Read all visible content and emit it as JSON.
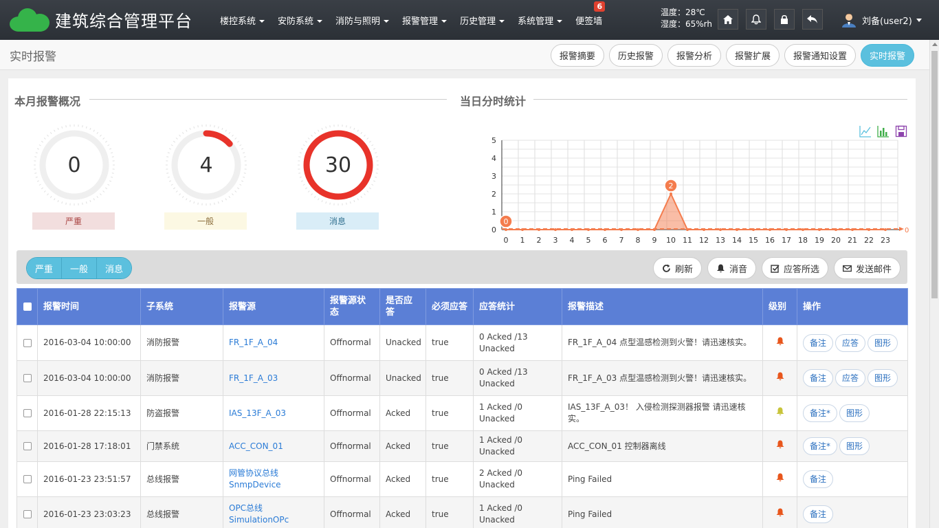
{
  "app": {
    "title": "建筑综合管理平台"
  },
  "menu": [
    {
      "label": "楼控系统",
      "caret": true
    },
    {
      "label": "安防系统",
      "caret": true
    },
    {
      "label": "消防与照明",
      "caret": true
    },
    {
      "label": "报警管理",
      "caret": true
    },
    {
      "label": "历史管理",
      "caret": true
    },
    {
      "label": "系统管理",
      "caret": true
    },
    {
      "label": "便签墙",
      "caret": false,
      "badge": "6"
    }
  ],
  "env": {
    "temperature": "温度：28℃",
    "humidity": "湿度：65%rh"
  },
  "nav_icons": [
    "home-icon",
    "bell-icon",
    "lock-icon",
    "back-icon"
  ],
  "user": {
    "name": "刘备(user2)"
  },
  "page": {
    "title": "实时报警"
  },
  "sub_tabs": [
    {
      "label": "报警摘要",
      "active": false
    },
    {
      "label": "历史报警",
      "active": false
    },
    {
      "label": "报警分析",
      "active": false
    },
    {
      "label": "报警扩展",
      "active": false
    },
    {
      "label": "报警通知设置",
      "active": false
    },
    {
      "label": "实时报警",
      "active": true
    }
  ],
  "summary": {
    "title": "本月报警概况",
    "gauges": [
      {
        "value": "0",
        "label": "严重",
        "color": "#e8332a",
        "fraction": 0.0,
        "label_bg": "#f2dede",
        "label_color": "#a94442"
      },
      {
        "value": "4",
        "label": "一般",
        "color": "#e8332a",
        "fraction": 0.133,
        "label_bg": "#fcf8e3",
        "label_color": "#8a6d3b"
      },
      {
        "value": "30",
        "label": "消息",
        "color": "#e8332a",
        "fraction": 1.0,
        "label_bg": "#d9edf7",
        "label_color": "#31708f"
      }
    ]
  },
  "hourly": {
    "title": "当日分时统计",
    "tools": [
      "line-chart-icon",
      "bar-chart-icon",
      "save-icon"
    ]
  },
  "chart_data": {
    "type": "area",
    "x": [
      "0",
      "1",
      "2",
      "3",
      "4",
      "5",
      "6",
      "7",
      "8",
      "9",
      "10",
      "11",
      "12",
      "13",
      "14",
      "15",
      "16",
      "17",
      "18",
      "19",
      "20",
      "21",
      "22",
      "23"
    ],
    "series": [
      {
        "values": [
          0,
          0,
          0,
          0,
          0,
          0,
          0,
          0,
          0,
          0,
          2,
          0,
          0,
          0,
          0,
          0,
          0,
          0,
          0,
          0,
          0,
          0,
          0,
          0
        ],
        "color": "#f47c4d"
      }
    ],
    "ylim": [
      0,
      5
    ],
    "yticks": [
      "0",
      "1",
      "2",
      "3",
      "4",
      "5"
    ],
    "markers": [
      {
        "x": "0",
        "label": "0"
      },
      {
        "x": "10",
        "label": "2"
      }
    ],
    "extra_label": "0",
    "grid": true
  },
  "toolbar": {
    "filters": [
      "严重",
      "一般",
      "消息"
    ],
    "buttons": [
      {
        "label": "刷新",
        "icon": "refresh-icon"
      },
      {
        "label": "消音",
        "icon": "bell-icon"
      },
      {
        "label": "应答所选",
        "icon": "checkbox-icon"
      },
      {
        "label": "发送邮件",
        "icon": "mail-icon"
      }
    ]
  },
  "table": {
    "headers": [
      "报警时间",
      "子系统",
      "报警源",
      "报警源状态",
      "是否应答",
      "必须应答",
      "应答统计",
      "报警描述",
      "级别",
      "操作"
    ],
    "rows": [
      {
        "time": "2016-03-04 10:00:00",
        "subsystem": "消防报警",
        "source": "FR_1F_A_04",
        "source_state": "Offnormal",
        "acked": "Unacked",
        "must_ack": "true",
        "stats": "0 Acked /13 Unacked",
        "desc": "FR_1F_A_04 点型温感检测到火警！请迅速核实。",
        "level_color": "#e8561c",
        "ops": [
          "备注",
          "应答",
          "图形"
        ]
      },
      {
        "time": "2016-03-04 10:00:00",
        "subsystem": "消防报警",
        "source": "FR_1F_A_03",
        "source_state": "Offnormal",
        "acked": "Unacked",
        "must_ack": "true",
        "stats": "0 Acked /13 Unacked",
        "desc": "FR_1F_A_03 点型温感检测到火警！请迅速核实。",
        "level_color": "#e8561c",
        "ops": [
          "备注",
          "应答",
          "图形"
        ]
      },
      {
        "time": "2016-01-28 22:15:13",
        "subsystem": "防盗报警",
        "source": "IAS_13F_A_03",
        "source_state": "Offnormal",
        "acked": "Acked",
        "must_ack": "true",
        "stats": "1 Acked /0 Unacked",
        "desc": "IAS_13F_A_03！ 入侵检测探测器报警 请迅速核实。",
        "level_color": "#c8c43a",
        "ops": [
          "备注*",
          "图形"
        ]
      },
      {
        "time": "2016-01-28 17:18:01",
        "subsystem": "门禁系统",
        "source": "ACC_CON_01",
        "source_state": "Offnormal",
        "acked": "Acked",
        "must_ack": "true",
        "stats": "1 Acked /0 Unacked",
        "desc": "ACC_CON_01 控制器离线",
        "level_color": "#e8561c",
        "ops": [
          "备注*",
          "图形"
        ]
      },
      {
        "time": "2016-01-23 23:51:57",
        "subsystem": "总线报警",
        "source": "网管协议总线 SnmpDevice",
        "source_state": "Offnormal",
        "acked": "Acked",
        "must_ack": "true",
        "stats": "2 Acked /0 Unacked",
        "desc": "Ping Failed",
        "level_color": "#e8561c",
        "ops": [
          "备注"
        ]
      },
      {
        "time": "2016-01-23 23:03:23",
        "subsystem": "总线报警",
        "source": "OPC总线 SimulationOPc",
        "source_state": "Offnormal",
        "acked": "Acked",
        "must_ack": "true",
        "stats": "1 Acked /0 Unacked",
        "desc": "Ping Failed",
        "level_color": "#e8561c",
        "ops": [
          "备注"
        ]
      }
    ]
  }
}
